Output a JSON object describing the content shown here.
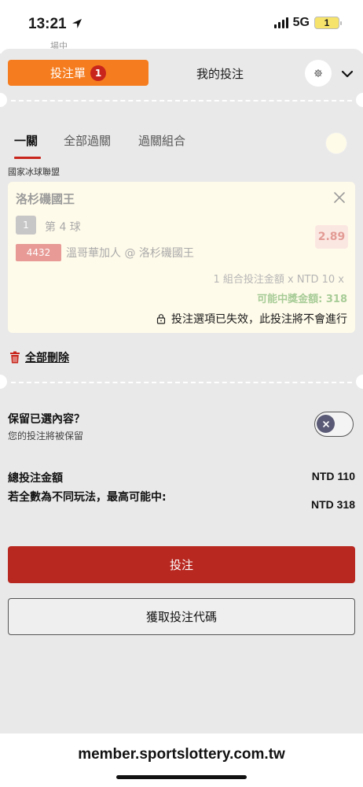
{
  "status_bar": {
    "time": "13:21",
    "network": "5G",
    "battery": "1"
  },
  "background_peek_text": "場中",
  "tabs": {
    "betslip_label": "投注單",
    "betslip_count": "1",
    "my_bets_label": "我的投注"
  },
  "bet_types": [
    {
      "label": "一關",
      "active": true
    },
    {
      "label": "全部過關",
      "active": false
    },
    {
      "label": "過關組合",
      "active": false
    }
  ],
  "league": "國家冰球聯盟",
  "bet_card": {
    "team": "洛杉磯國王",
    "period_number": "1",
    "period_label": "第 4 球",
    "game_code": "4432",
    "matchup": "溫哥華加人 @ 洛杉磯國王",
    "odds": "2.89",
    "combo_text": "1 組合投注金額 x NTD 10 x",
    "potential_text": "可能中獎金額: 318",
    "invalid_text": "投注選項已失效，此投注將不會進行"
  },
  "delete_all_label": "全部刪除",
  "keep_selection": {
    "title": "保留已選內容？",
    "subtitle": "您的投注將被保留",
    "enabled": false
  },
  "totals": {
    "total_label": "總投注金額",
    "total_value": "NTD 110",
    "max_label": "若全數為不同玩法，最高可能中:",
    "max_value": "NTD 318"
  },
  "buttons": {
    "place_bet": "投注",
    "get_code": "獲取投注代碼"
  },
  "url": "member.sportslottery.com.tw",
  "colors": {
    "accent_orange": "#f57d1f",
    "brand_red": "#b82820",
    "success_green": "#a7cc97"
  }
}
